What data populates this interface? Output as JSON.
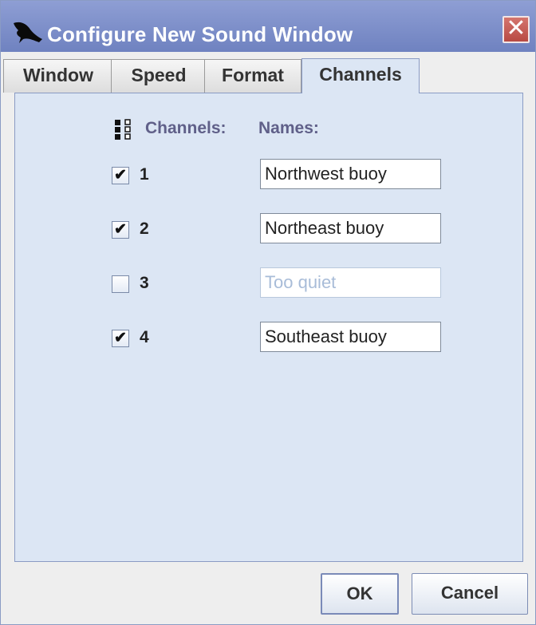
{
  "window": {
    "title": "Configure New Sound Window",
    "close_symbol": "✕"
  },
  "tabs": [
    {
      "label": "Window",
      "active": false
    },
    {
      "label": "Speed",
      "active": false
    },
    {
      "label": "Format",
      "active": false
    },
    {
      "label": "Channels",
      "active": true
    }
  ],
  "channels_panel": {
    "channels_header": "Channels:",
    "names_header": "Names:",
    "rows": [
      {
        "number": "1",
        "checked": true,
        "name": "Northwest buoy",
        "enabled": true
      },
      {
        "number": "2",
        "checked": true,
        "name": "Northeast buoy",
        "enabled": true
      },
      {
        "number": "3",
        "checked": false,
        "name": "Too quiet",
        "enabled": false
      },
      {
        "number": "4",
        "checked": true,
        "name": "Southeast buoy",
        "enabled": true
      }
    ]
  },
  "buttons": {
    "ok": "OK",
    "cancel": "Cancel"
  },
  "icons": {
    "app": "bird-icon",
    "columns": "columns-icon",
    "close": "close-icon",
    "check_mark": "✔"
  },
  "colors": {
    "title_bar": "#7d8fcb",
    "panel": "#dce6f4",
    "header_text": "#606089",
    "close_button": "#c25a52"
  }
}
